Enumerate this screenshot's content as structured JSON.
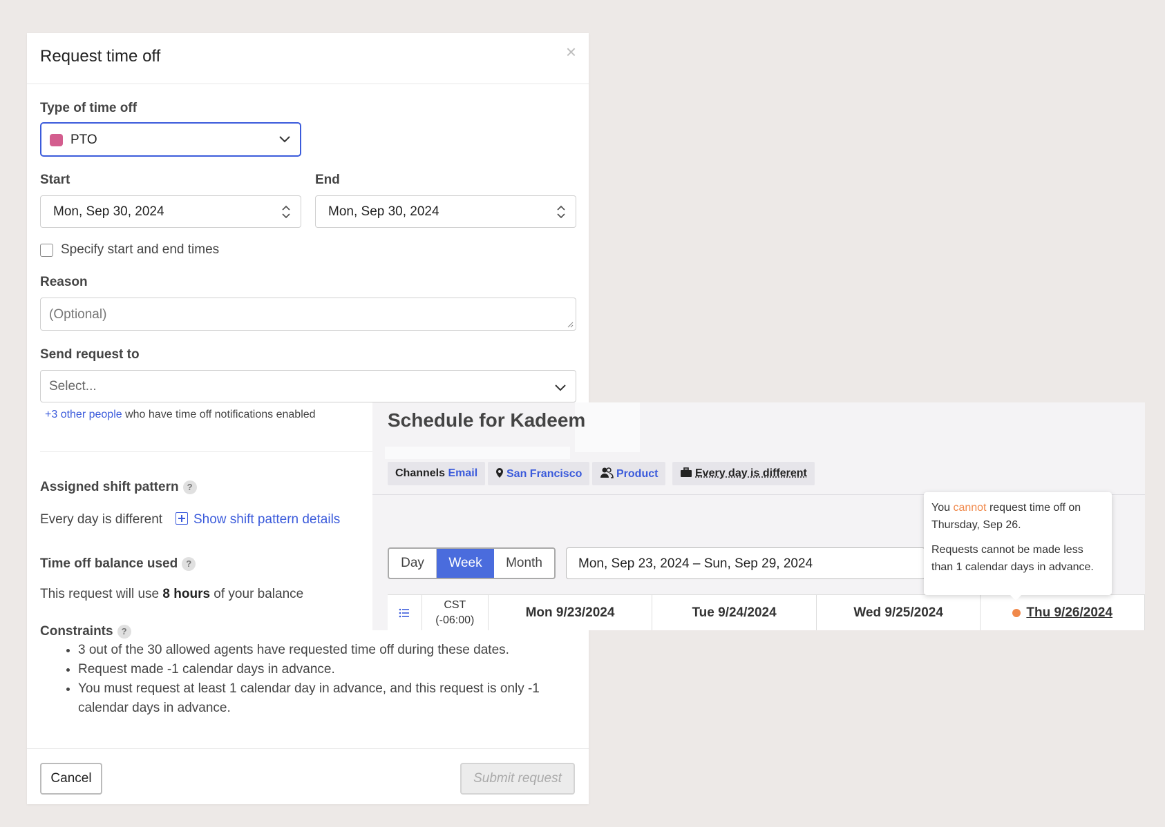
{
  "modal": {
    "title": "Request time off",
    "close_symbol": "×",
    "type_label": "Type of time off",
    "type_value": "PTO",
    "type_color": "#d35d8e",
    "start_label": "Start",
    "start_value": "Mon, Sep 30, 2024",
    "end_label": "End",
    "end_value": "Mon, Sep 30, 2024",
    "specify_times_label": "Specify start and end times",
    "reason_label": "Reason",
    "reason_placeholder": "(Optional)",
    "send_to_label": "Send request to",
    "send_to_placeholder": "Select...",
    "notif_link": "+3 other people",
    "notif_text": " who have time off notifications enabled",
    "shift_pattern_label": "Assigned shift pattern",
    "shift_pattern_value": "Every day is different",
    "shift_pattern_link": "Show shift pattern details",
    "balance_label": "Time off balance used",
    "balance_prefix": "This request will use ",
    "balance_amount": "8 hours",
    "balance_suffix": " of your balance",
    "constraints_label": "Constraints",
    "constraints": [
      "3 out of the 30 allowed agents have requested time off during these dates.",
      "Request made -1 calendar days in advance.",
      "You must request at least 1 calendar day in advance, and this request is only -1 calendar days in advance."
    ],
    "help_symbol": "?",
    "cancel_label": "Cancel",
    "submit_label": "Submit request"
  },
  "schedule": {
    "title": "Schedule for Kadeem",
    "chips": {
      "channels_label": "Channels",
      "channels_value": "Email",
      "location": "San Francisco",
      "team": "Product",
      "pattern": "Every day is different"
    },
    "views": [
      "Day",
      "Week",
      "Month"
    ],
    "active_view": "Week",
    "range": "Mon, Sep 23, 2024 – Sun, Sep 29, 2024",
    "timezone_line1": "CST",
    "timezone_line2": "(-06:00)",
    "days": [
      "Mon 9/23/2024",
      "Tue 9/24/2024",
      "Wed 9/25/2024",
      "Thu 9/26/2024"
    ],
    "warning_color": "#f0884a"
  },
  "tooltip": {
    "line1_prefix": "You ",
    "line1_warn": "cannot",
    "line1_suffix": " request time off on Thursday, Sep 26.",
    "line2": "Requests cannot be made less than 1 calendar days in advance."
  }
}
